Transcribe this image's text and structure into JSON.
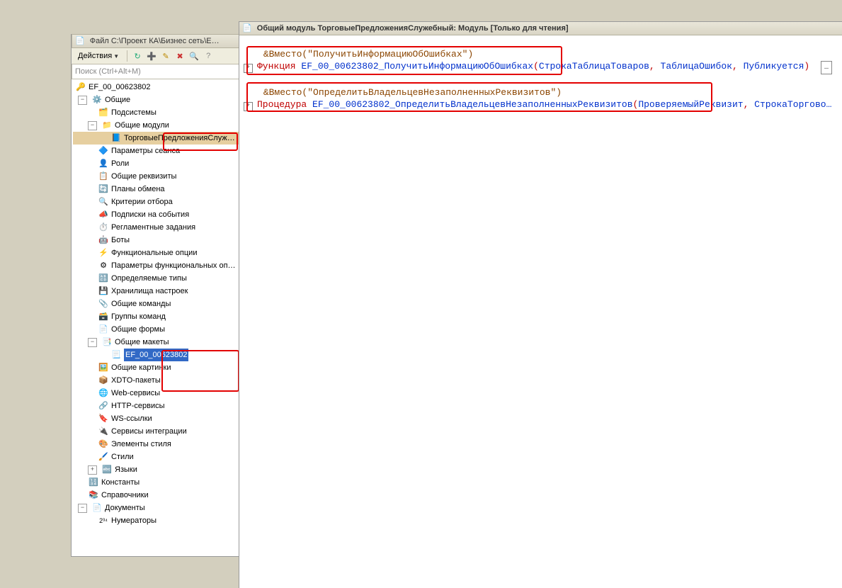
{
  "left_panel": {
    "title": "Файл C:\\Проект КА\\Бизнес сеть\\Е…",
    "toolbar": {
      "actions_label": "Действия",
      "icons": [
        "refresh",
        "add",
        "edit",
        "delete",
        "search",
        "help"
      ]
    },
    "search_placeholder": "Поиск (Ctrl+Alt+M)"
  },
  "tree": {
    "root_label": "EF_00_00623802",
    "common_label": "Общие",
    "items": [
      {
        "icon": "subsystems",
        "label": "Подсистемы",
        "expand": ""
      },
      {
        "icon": "folder",
        "label": "Общие модули",
        "expand": "-",
        "children": [
          {
            "icon": "module",
            "label": "ТорговыеПредложенияСлуж…",
            "active": true
          }
        ]
      },
      {
        "icon": "param",
        "label": "Параметры сеанса",
        "expand": ""
      },
      {
        "icon": "roles",
        "label": "Роли",
        "expand": ""
      },
      {
        "icon": "commonreq",
        "label": "Общие реквизиты",
        "expand": ""
      },
      {
        "icon": "exchange",
        "label": "Планы обмена",
        "expand": ""
      },
      {
        "icon": "criteria",
        "label": "Критерии отбора",
        "expand": ""
      },
      {
        "icon": "subscribe",
        "label": "Подписки на события",
        "expand": ""
      },
      {
        "icon": "scheduled",
        "label": "Регламентные задания",
        "expand": ""
      },
      {
        "icon": "bots",
        "label": "Боты",
        "expand": ""
      },
      {
        "icon": "funcopt",
        "label": "Функциональные опции",
        "expand": ""
      },
      {
        "icon": "funcoptparam",
        "label": "Параметры функциональных оп…",
        "expand": ""
      },
      {
        "icon": "definedtypes",
        "label": "Определяемые типы",
        "expand": ""
      },
      {
        "icon": "settingsstorage",
        "label": "Хранилища настроек",
        "expand": ""
      },
      {
        "icon": "commoncommands",
        "label": "Общие команды",
        "expand": ""
      },
      {
        "icon": "cmdgroups",
        "label": "Группы команд",
        "expand": ""
      },
      {
        "icon": "commonforms",
        "label": "Общие формы",
        "expand": ""
      },
      {
        "icon": "templates",
        "label": "Общие макеты",
        "expand": "-",
        "children": [
          {
            "icon": "template",
            "label": "EF_00_00623802",
            "selected": true
          }
        ]
      },
      {
        "icon": "pictures",
        "label": "Общие картинки",
        "expand": ""
      },
      {
        "icon": "xdto",
        "label": "XDTO-пакеты",
        "expand": ""
      },
      {
        "icon": "webservices",
        "label": "Web-сервисы",
        "expand": ""
      },
      {
        "icon": "httpservices",
        "label": "HTTP-сервисы",
        "expand": ""
      },
      {
        "icon": "wsref",
        "label": "WS-ссылки",
        "expand": ""
      },
      {
        "icon": "integrationservices",
        "label": "Сервисы интеграции",
        "expand": ""
      },
      {
        "icon": "styleitems",
        "label": "Элементы стиля",
        "expand": ""
      },
      {
        "icon": "styles",
        "label": "Стили",
        "expand": ""
      },
      {
        "icon": "languages",
        "label": "Языки",
        "expand": "+"
      }
    ],
    "after_common": [
      {
        "icon": "constants",
        "label": "Константы"
      },
      {
        "icon": "catalogs",
        "label": "Справочники"
      },
      {
        "icon": "documents",
        "label": "Документы",
        "expand": "-",
        "children": [
          {
            "icon": "numerators",
            "label": "Нумераторы"
          }
        ]
      }
    ]
  },
  "code_panel": {
    "title": "Общий модуль ТорговыеПредложенияСлужебный: Модуль [Только для чтения]",
    "block1": {
      "annotation": "&Вместо(\"ПолучитьИнформациюОбОшибках\")",
      "keyword": "Функция",
      "funcname": "EF_00_00623802_ПолучитьИнформациюОбОшибках",
      "params": [
        "СтрокаТаблицаТоваров",
        "ТаблицаОшибок",
        "Публикуется"
      ]
    },
    "block2": {
      "annotation": "&Вместо(\"ОпределитьВладельцевНезаполненныхРеквизитов\")",
      "keyword": "Процедура",
      "funcname": "EF_00_00623802_ОпределитьВладельцевНезаполненныхРеквизитов",
      "params": [
        "ПроверяемыйРеквизит",
        "СтрокаТоргово…"
      ]
    }
  }
}
